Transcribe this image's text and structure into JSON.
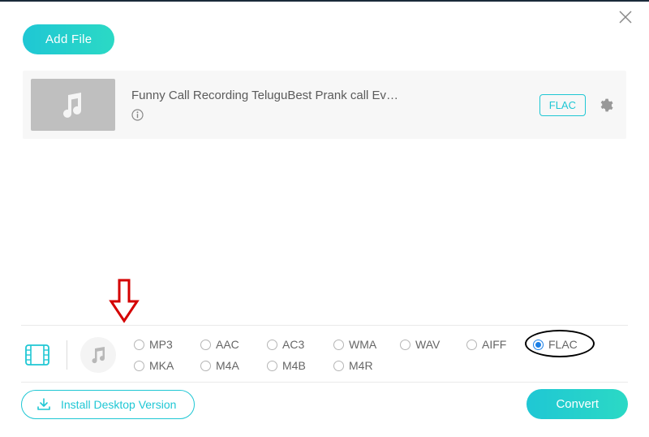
{
  "header": {
    "add_file_label": "Add File"
  },
  "file": {
    "title": "Funny Call Recording TeluguBest Prank call Ev…",
    "format_badge": "FLAC"
  },
  "formats": {
    "row1": [
      "MP3",
      "AAC",
      "AC3",
      "WMA",
      "WAV",
      "AIFF",
      "FLAC"
    ],
    "row2": [
      "MKA",
      "M4A",
      "M4B",
      "M4R"
    ],
    "selected": "FLAC"
  },
  "footer": {
    "install_label": "Install Desktop Version",
    "convert_label": "Convert"
  },
  "icons": {
    "close": "close-icon",
    "music_note": "music-note-icon",
    "info": "info-icon",
    "gear": "gear-icon",
    "film": "film-icon",
    "download": "download-icon"
  }
}
